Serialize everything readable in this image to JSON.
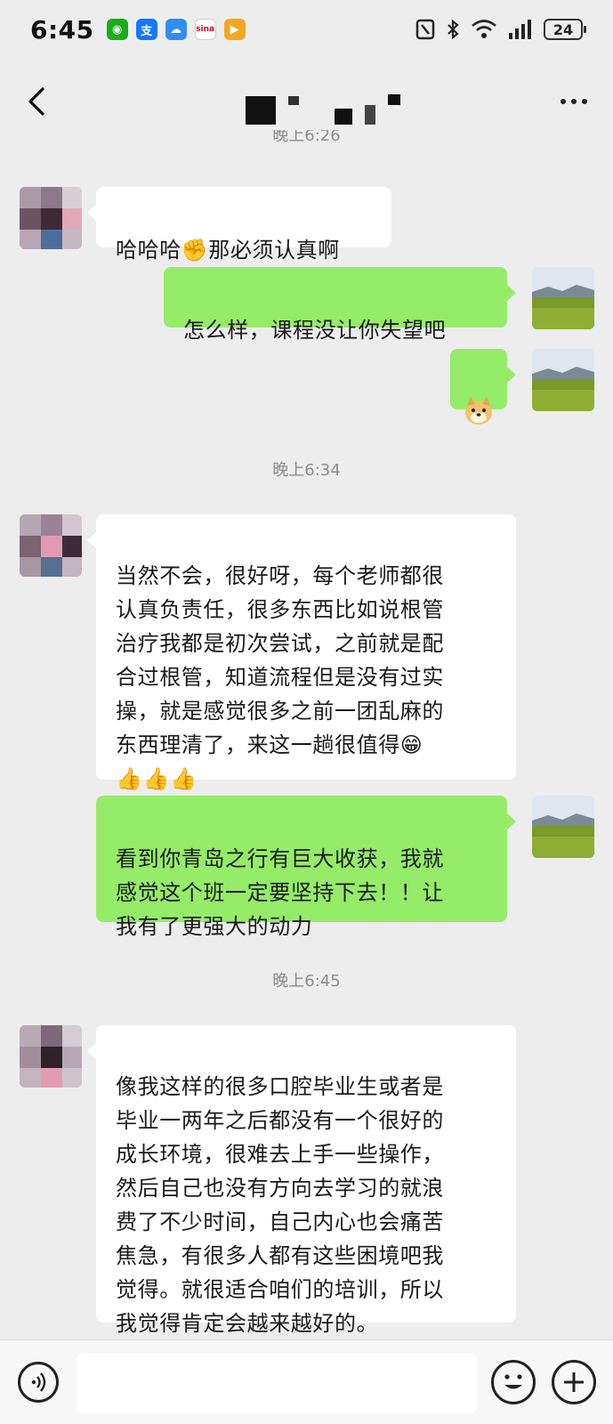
{
  "status_bar": {
    "time": "6:45",
    "battery": "24",
    "app_icons": [
      "wechat-icon",
      "alipay-icon",
      "cloud-icon",
      "sina-icon",
      "video-icon"
    ],
    "system_icons": [
      "nfc-icon",
      "bluetooth-icon",
      "wifi-icon",
      "signal-icon",
      "battery-icon"
    ]
  },
  "header": {
    "title": "",
    "back_icon": "back-arrow-icon",
    "more_icon": "more-dots-icon"
  },
  "chat": {
    "timestamps": [
      "晚上6:26",
      "晚上6:34",
      "晚上6:45"
    ],
    "messages": [
      {
        "from": "contact",
        "text": "哈哈哈✊那必须认真啊"
      },
      {
        "from": "me",
        "text": "怎么样，课程没让你失望吧"
      },
      {
        "from": "me",
        "text": "🐶",
        "sticker": "doge-emoji-icon"
      },
      {
        "from": "contact",
        "text": "当然不会，很好呀，每个老师都很\n认真负责任，很多东西比如说根管\n治疗我都是初次尝试，之前就是配\n合过根管，知道流程但是没有过实\n操，就是感觉很多之前一团乱麻的\n东西理清了，来这一趟很值得😁\n👍👍👍"
      },
      {
        "from": "me",
        "text": "看到你青岛之行有巨大收获，我就\n感觉这个班一定要坚持下去！！让\n我有了更强大的动力"
      },
      {
        "from": "contact",
        "text": "像我这样的很多口腔毕业生或者是\n毕业一两年之后都没有一个很好的\n成长环境，很难去上手一些操作，\n然后自己也没有方向去学习的就浪\n费了不少时间，自己内心也会痛苦\n焦急，有很多人都有这些困境吧我\n觉得。就很适合咱们的培训，所以\n我觉得肯定会越来越好的。"
      }
    ]
  },
  "input_bar": {
    "voice_icon": "voice-icon",
    "emoji_icon": "emoji-icon",
    "plus_icon": "plus-icon"
  },
  "colors": {
    "background": "#ededed",
    "my_bubble": "#95ec69",
    "their_bubble": "#ffffff",
    "timestamp": "#8c8c8c"
  }
}
